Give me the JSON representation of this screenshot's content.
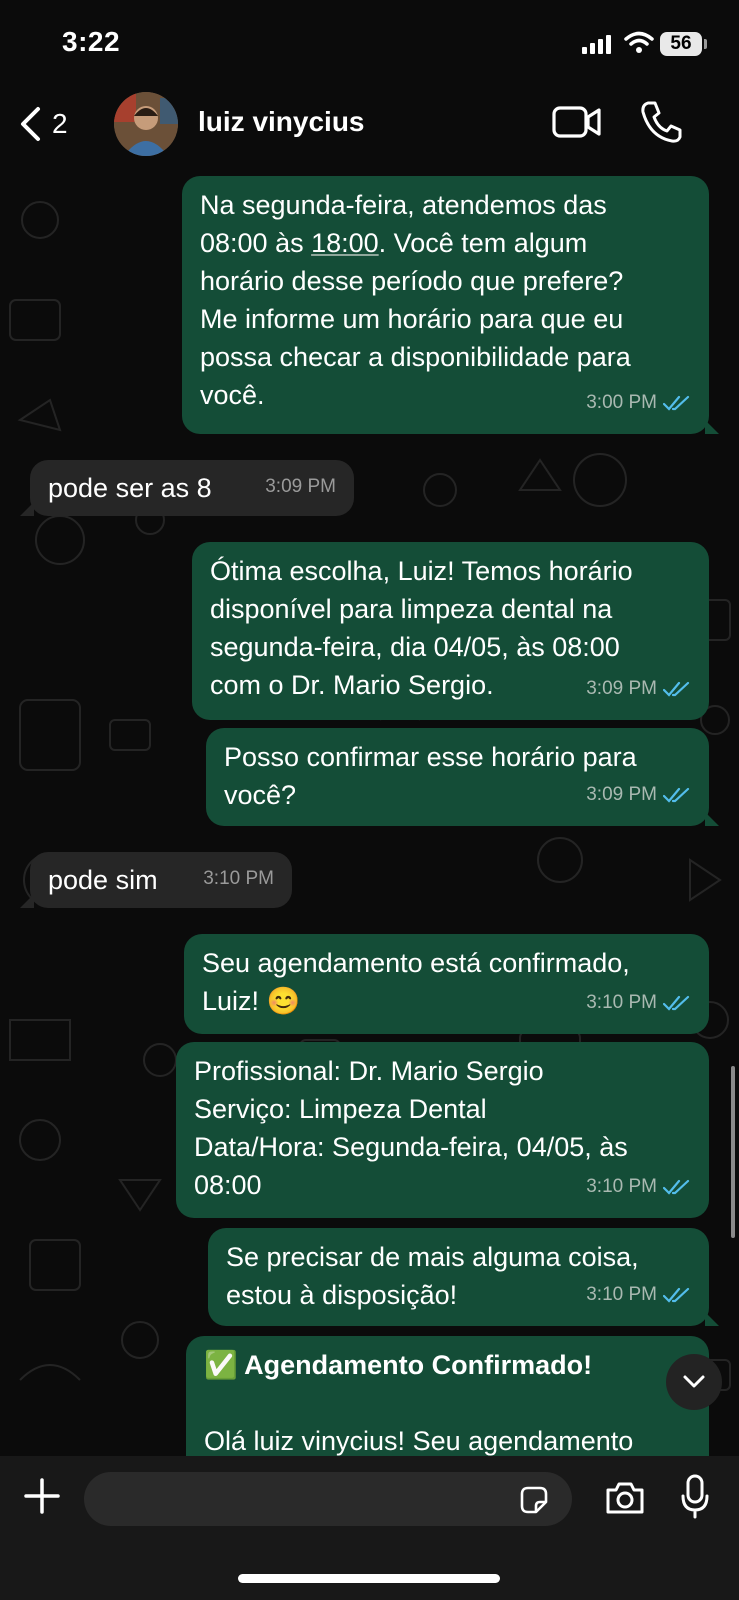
{
  "status_bar": {
    "time": "3:22",
    "battery": "56"
  },
  "header": {
    "back_count": "2",
    "contact_name": "luiz vinycius"
  },
  "messages": [
    {
      "id": "m1",
      "direction": "out",
      "text_before": "Na segunda-feira, atendemos das\n08:00 às ",
      "text_link": "18:00",
      "text_after": ". Você tem algum\nhorário desse período que prefere?\nMe informe um horário para que eu\npossa checar a disponibilidade para\nvocê.",
      "time": "3:00 PM",
      "status": "read"
    },
    {
      "id": "m2",
      "direction": "in",
      "text": "pode ser as 8",
      "time": "3:09 PM"
    },
    {
      "id": "m3",
      "direction": "out",
      "text": "Ótima escolha, Luiz! Temos horário\ndisponível para limpeza dental na\nsegunda-feira, dia 04/05, às 08:00\ncom o Dr. Mario Sergio.",
      "time": "3:09 PM",
      "status": "read"
    },
    {
      "id": "m4",
      "direction": "out",
      "text": "Posso confirmar esse horário para\nvocê?",
      "time": "3:09 PM",
      "status": "read"
    },
    {
      "id": "m5",
      "direction": "in",
      "text": "pode sim",
      "time": "3:10 PM"
    },
    {
      "id": "m6",
      "direction": "out",
      "text": "Seu agendamento está confirmado,\nLuiz! 😊",
      "time": "3:10 PM",
      "status": "read"
    },
    {
      "id": "m7",
      "direction": "out",
      "text": "Profissional: Dr. Mario Sergio\nServiço: Limpeza Dental\nData/Hora: Segunda-feira, 04/05, às\n08:00",
      "time": "3:10 PM",
      "status": "read"
    },
    {
      "id": "m8",
      "direction": "out",
      "text": "Se precisar de mais alguma coisa,\nestou à disposição!",
      "time": "3:10 PM",
      "status": "read"
    },
    {
      "id": "m9",
      "direction": "out",
      "emoji": "✅",
      "title": "Agendamento Confirmado!",
      "text": "Olá luiz vinycius! Seu agendamento"
    }
  ],
  "composer": {
    "placeholder": ""
  },
  "colors": {
    "outgoing": "#144d37",
    "incoming": "#262626",
    "read_ticks": "#53bdeb"
  },
  "icons": [
    "back-chevron-icon",
    "video-call-icon",
    "phone-icon",
    "chevron-down-icon",
    "plus-icon",
    "sticker-icon",
    "camera-icon",
    "microphone-icon",
    "double-check-icon"
  ]
}
